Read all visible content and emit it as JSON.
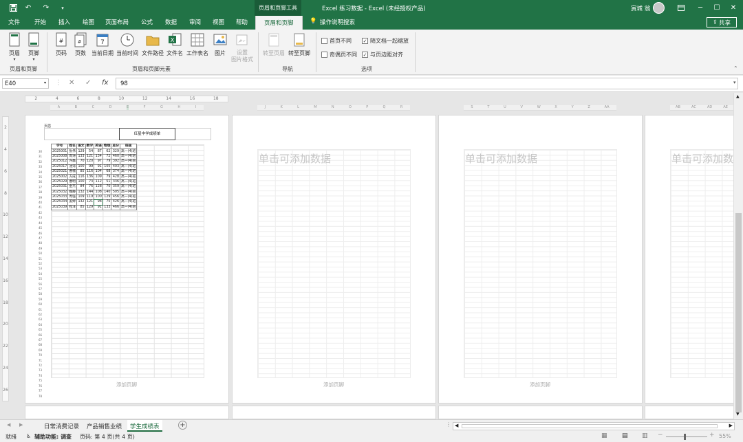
{
  "titlebar": {
    "context_tool": "页眉和页脚工具",
    "window_title": "Excel 练习数据  -  Excel (未经授权产品)",
    "user_name": "寅城 翁",
    "icons": [
      "save-icon",
      "undo-icon",
      "redo-icon",
      "customize-icon",
      "ribbon-display-icon",
      "minimize-icon",
      "restore-icon",
      "close-icon"
    ]
  },
  "tabs": [
    "文件",
    "开始",
    "插入",
    "绘图",
    "页面布局",
    "公式",
    "数据",
    "审阅",
    "视图",
    "帮助",
    "页眉和页脚"
  ],
  "tell_me": "操作说明搜索",
  "share_label": "共享",
  "ribbon": {
    "g1": {
      "label": "页眉和页脚",
      "buttons": [
        "页眉",
        "页脚"
      ]
    },
    "g2": {
      "label": "页眉和页脚元素",
      "buttons": [
        "页码",
        "页数",
        "当前日期",
        "当前时间",
        "文件路径",
        "文件名",
        "工作表名",
        "图片"
      ],
      "disabled": "设置\n图片格式"
    },
    "g3": {
      "label": "导航",
      "buttons": [
        "转至页眉",
        "转至页脚"
      ]
    },
    "g4": {
      "label": "选项",
      "options": [
        {
          "label": "首页不同",
          "checked": false
        },
        {
          "label": "随文档一起缩放",
          "checked": true
        },
        {
          "label": "奇偶页不同",
          "checked": false
        },
        {
          "label": "与页边距对齐",
          "checked": true
        }
      ]
    }
  },
  "formula_bar": {
    "name_box": "E40",
    "value": "98"
  },
  "ruler": {
    "ticks": [
      "2",
      "4",
      "6",
      "8",
      "10",
      "12",
      "14",
      "16",
      "18"
    ]
  },
  "col_letters": [
    "A",
    "B",
    "C",
    "D",
    "E",
    "F",
    "G",
    "H",
    "I"
  ],
  "col_letters_p2": [
    "J",
    "K",
    "L",
    "M",
    "N",
    "O",
    "P",
    "Q",
    "R"
  ],
  "col_letters_p3": [
    "S",
    "T",
    "U",
    "V",
    "W",
    "X",
    "Y",
    "Z",
    "AA"
  ],
  "col_letters_p4": [
    "AB",
    "AC",
    "AD",
    "AE"
  ],
  "vruler_ticks": [
    "2",
    "4",
    "6",
    "8",
    "10",
    "12",
    "14",
    "16",
    "18",
    "20",
    "22",
    "24",
    "26"
  ],
  "page1": {
    "header_left": "页眉",
    "header_center": "红星中学成绩单",
    "footer_hint": "添加页脚",
    "row_numbers": [
      "30",
      "31",
      "32",
      "33",
      "34",
      "35",
      "36",
      "37",
      "38",
      "39",
      "40",
      "41",
      "42",
      "43",
      "44",
      "45",
      "46",
      "47",
      "48",
      "49",
      "50",
      "51",
      "52",
      "53",
      "54",
      "55",
      "56",
      "57",
      "58",
      "59",
      "60",
      "61",
      "62",
      "63",
      "64",
      "65",
      "66",
      "67",
      "68",
      "69",
      "70",
      "71",
      "72",
      "73",
      "74",
      "75",
      "76",
      "77",
      "78"
    ],
    "columns": [
      "学号",
      "姓名",
      "语文",
      "数学",
      "英语",
      "物理",
      "总分",
      "班级"
    ],
    "rows": [
      [
        "2025001",
        "张伟",
        "129",
        "54",
        "87",
        "62",
        "329",
        "高一(4)班"
      ],
      [
        "2025008",
        "周涛",
        "133",
        "121",
        "134",
        "72",
        "460",
        "高一(4)班"
      ],
      [
        "2025012",
        "许磊",
        "70",
        "120",
        "97",
        "79",
        "392",
        "高一(4)班"
      ],
      [
        "2025017",
        "沈涛",
        "100",
        "99",
        "91",
        "105",
        "403",
        "高一(4)班"
      ],
      [
        "2025021",
        "曹楠",
        "85",
        "116",
        "104",
        "68",
        "374",
        "高一(4)班"
      ],
      [
        "2025002",
        "方成",
        "116",
        "136",
        "109",
        "79",
        "428",
        "高一(4)班"
      ],
      [
        "2025029",
        "曹明",
        "100",
        "73",
        "112",
        "51",
        "336",
        "高一(4)班"
      ],
      [
        "2025031",
        "金杰",
        "84",
        "76",
        "128",
        "70",
        "359",
        "高一(4)班"
      ],
      [
        "2025032",
        "魏静",
        "132",
        "144",
        "108",
        "140",
        "505",
        "高一(4)班"
      ],
      [
        "2025033",
        "周强",
        "109",
        "119",
        "100",
        "129",
        "456",
        "高一(4)班"
      ],
      [
        "2025034",
        "姜婷",
        "132",
        "121",
        "98",
        "75",
        "426",
        "高一(4)班"
      ],
      [
        "2025039",
        "程洋",
        "85",
        "129",
        "91",
        "133",
        "466",
        "高一(4)班"
      ]
    ]
  },
  "placeholder_add_data": "单击可添加数据",
  "placeholder_add_footer": "添加页脚",
  "sheets": [
    "日常消费记录",
    "产品销售业绩",
    "学生成绩表"
  ],
  "active_sheet": "学生成绩表",
  "status": {
    "ready": "就绪",
    "accessibility": "辅助功能: 调查",
    "page": "页码: 第 4 页(共 4 页)",
    "zoom": "55%"
  }
}
